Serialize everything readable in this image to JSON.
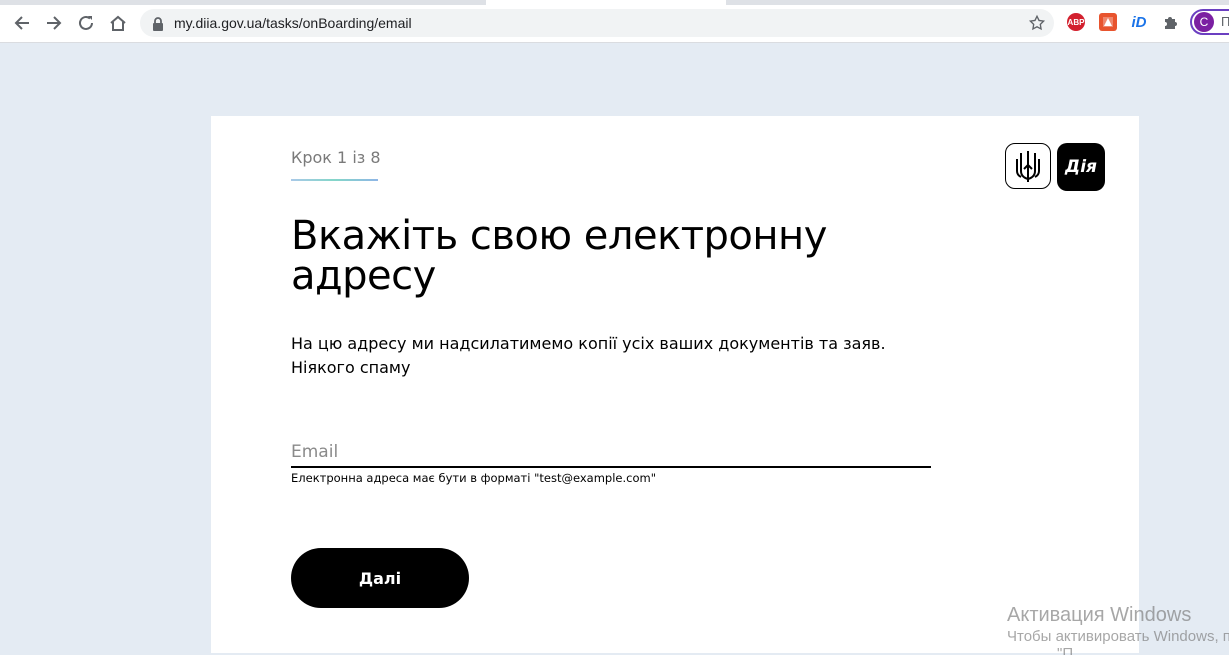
{
  "browser": {
    "url": "my.diia.gov.ua/tasks/onBoarding/email",
    "profile_initial": "C",
    "profile_name_partial": "П",
    "extensions": {
      "abp_label": "ABP",
      "id_label": "iD"
    },
    "icons": [
      "back-icon",
      "forward-icon",
      "reload-icon",
      "home-icon",
      "lock-icon",
      "star-icon",
      "puzzle-icon"
    ]
  },
  "page": {
    "step": "Крок 1 із 8",
    "logo_text": "Дія",
    "title": "Вкажіть свою електронну адресу",
    "subtitle": "На цю адресу ми надсилатимемо копії усіх ваших документів та заяв. Ніякого спаму",
    "email": {
      "placeholder": "Email",
      "value": "",
      "hint": "Електронна адреса має бути в форматі \"test@example.com\""
    },
    "next_button": "Далі"
  },
  "watermark": {
    "line1": "Активация Windows",
    "line2": "Чтобы активировать Windows, п",
    "line3": "\"П"
  },
  "colors": {
    "page_background": "#e4ebf3",
    "card_background": "#ffffff",
    "button_background": "#000000",
    "profile_ring": "#6b3fc1"
  }
}
